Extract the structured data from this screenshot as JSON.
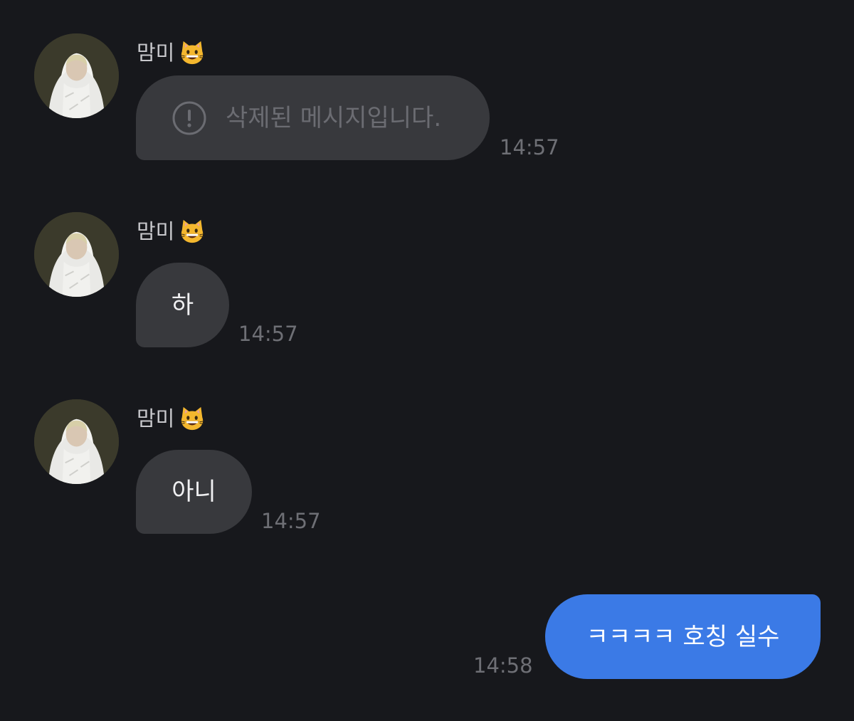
{
  "messages": [
    {
      "sender": "맘미",
      "sender_emoji": "grinning-cat-icon",
      "text": "삭제된 메시지입니다.",
      "deleted": true,
      "time": "14:57"
    },
    {
      "sender": "맘미",
      "sender_emoji": "grinning-cat-icon",
      "text": "하",
      "time": "14:57"
    },
    {
      "sender": "맘미",
      "sender_emoji": "grinning-cat-icon",
      "text": "아니",
      "time": "14:57"
    },
    {
      "outgoing": true,
      "text": "ㅋㅋㅋㅋ 호칭 실수",
      "time": "14:58"
    }
  ],
  "colors": {
    "background": "#17181c",
    "incoming_bubble": "#38393d",
    "outgoing_bubble": "#3b7ae6",
    "timestamp": "#6e6f75"
  }
}
